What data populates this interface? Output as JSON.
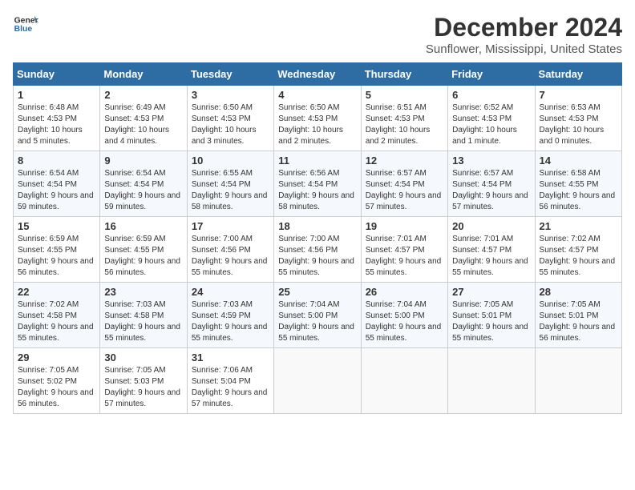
{
  "header": {
    "logo_line1": "General",
    "logo_line2": "Blue",
    "month": "December 2024",
    "location": "Sunflower, Mississippi, United States"
  },
  "weekdays": [
    "Sunday",
    "Monday",
    "Tuesday",
    "Wednesday",
    "Thursday",
    "Friday",
    "Saturday"
  ],
  "weeks": [
    [
      {
        "day": "1",
        "sunrise": "Sunrise: 6:48 AM",
        "sunset": "Sunset: 4:53 PM",
        "daylight": "Daylight: 10 hours and 5 minutes."
      },
      {
        "day": "2",
        "sunrise": "Sunrise: 6:49 AM",
        "sunset": "Sunset: 4:53 PM",
        "daylight": "Daylight: 10 hours and 4 minutes."
      },
      {
        "day": "3",
        "sunrise": "Sunrise: 6:50 AM",
        "sunset": "Sunset: 4:53 PM",
        "daylight": "Daylight: 10 hours and 3 minutes."
      },
      {
        "day": "4",
        "sunrise": "Sunrise: 6:50 AM",
        "sunset": "Sunset: 4:53 PM",
        "daylight": "Daylight: 10 hours and 2 minutes."
      },
      {
        "day": "5",
        "sunrise": "Sunrise: 6:51 AM",
        "sunset": "Sunset: 4:53 PM",
        "daylight": "Daylight: 10 hours and 2 minutes."
      },
      {
        "day": "6",
        "sunrise": "Sunrise: 6:52 AM",
        "sunset": "Sunset: 4:53 PM",
        "daylight": "Daylight: 10 hours and 1 minute."
      },
      {
        "day": "7",
        "sunrise": "Sunrise: 6:53 AM",
        "sunset": "Sunset: 4:53 PM",
        "daylight": "Daylight: 10 hours and 0 minutes."
      }
    ],
    [
      {
        "day": "8",
        "sunrise": "Sunrise: 6:54 AM",
        "sunset": "Sunset: 4:54 PM",
        "daylight": "Daylight: 9 hours and 59 minutes."
      },
      {
        "day": "9",
        "sunrise": "Sunrise: 6:54 AM",
        "sunset": "Sunset: 4:54 PM",
        "daylight": "Daylight: 9 hours and 59 minutes."
      },
      {
        "day": "10",
        "sunrise": "Sunrise: 6:55 AM",
        "sunset": "Sunset: 4:54 PM",
        "daylight": "Daylight: 9 hours and 58 minutes."
      },
      {
        "day": "11",
        "sunrise": "Sunrise: 6:56 AM",
        "sunset": "Sunset: 4:54 PM",
        "daylight": "Daylight: 9 hours and 58 minutes."
      },
      {
        "day": "12",
        "sunrise": "Sunrise: 6:57 AM",
        "sunset": "Sunset: 4:54 PM",
        "daylight": "Daylight: 9 hours and 57 minutes."
      },
      {
        "day": "13",
        "sunrise": "Sunrise: 6:57 AM",
        "sunset": "Sunset: 4:54 PM",
        "daylight": "Daylight: 9 hours and 57 minutes."
      },
      {
        "day": "14",
        "sunrise": "Sunrise: 6:58 AM",
        "sunset": "Sunset: 4:55 PM",
        "daylight": "Daylight: 9 hours and 56 minutes."
      }
    ],
    [
      {
        "day": "15",
        "sunrise": "Sunrise: 6:59 AM",
        "sunset": "Sunset: 4:55 PM",
        "daylight": "Daylight: 9 hours and 56 minutes."
      },
      {
        "day": "16",
        "sunrise": "Sunrise: 6:59 AM",
        "sunset": "Sunset: 4:55 PM",
        "daylight": "Daylight: 9 hours and 56 minutes."
      },
      {
        "day": "17",
        "sunrise": "Sunrise: 7:00 AM",
        "sunset": "Sunset: 4:56 PM",
        "daylight": "Daylight: 9 hours and 55 minutes."
      },
      {
        "day": "18",
        "sunrise": "Sunrise: 7:00 AM",
        "sunset": "Sunset: 4:56 PM",
        "daylight": "Daylight: 9 hours and 55 minutes."
      },
      {
        "day": "19",
        "sunrise": "Sunrise: 7:01 AM",
        "sunset": "Sunset: 4:57 PM",
        "daylight": "Daylight: 9 hours and 55 minutes."
      },
      {
        "day": "20",
        "sunrise": "Sunrise: 7:01 AM",
        "sunset": "Sunset: 4:57 PM",
        "daylight": "Daylight: 9 hours and 55 minutes."
      },
      {
        "day": "21",
        "sunrise": "Sunrise: 7:02 AM",
        "sunset": "Sunset: 4:57 PM",
        "daylight": "Daylight: 9 hours and 55 minutes."
      }
    ],
    [
      {
        "day": "22",
        "sunrise": "Sunrise: 7:02 AM",
        "sunset": "Sunset: 4:58 PM",
        "daylight": "Daylight: 9 hours and 55 minutes."
      },
      {
        "day": "23",
        "sunrise": "Sunrise: 7:03 AM",
        "sunset": "Sunset: 4:58 PM",
        "daylight": "Daylight: 9 hours and 55 minutes."
      },
      {
        "day": "24",
        "sunrise": "Sunrise: 7:03 AM",
        "sunset": "Sunset: 4:59 PM",
        "daylight": "Daylight: 9 hours and 55 minutes."
      },
      {
        "day": "25",
        "sunrise": "Sunrise: 7:04 AM",
        "sunset": "Sunset: 5:00 PM",
        "daylight": "Daylight: 9 hours and 55 minutes."
      },
      {
        "day": "26",
        "sunrise": "Sunrise: 7:04 AM",
        "sunset": "Sunset: 5:00 PM",
        "daylight": "Daylight: 9 hours and 55 minutes."
      },
      {
        "day": "27",
        "sunrise": "Sunrise: 7:05 AM",
        "sunset": "Sunset: 5:01 PM",
        "daylight": "Daylight: 9 hours and 55 minutes."
      },
      {
        "day": "28",
        "sunrise": "Sunrise: 7:05 AM",
        "sunset": "Sunset: 5:01 PM",
        "daylight": "Daylight: 9 hours and 56 minutes."
      }
    ],
    [
      {
        "day": "29",
        "sunrise": "Sunrise: 7:05 AM",
        "sunset": "Sunset: 5:02 PM",
        "daylight": "Daylight: 9 hours and 56 minutes."
      },
      {
        "day": "30",
        "sunrise": "Sunrise: 7:05 AM",
        "sunset": "Sunset: 5:03 PM",
        "daylight": "Daylight: 9 hours and 57 minutes."
      },
      {
        "day": "31",
        "sunrise": "Sunrise: 7:06 AM",
        "sunset": "Sunset: 5:04 PM",
        "daylight": "Daylight: 9 hours and 57 minutes."
      },
      null,
      null,
      null,
      null
    ]
  ]
}
